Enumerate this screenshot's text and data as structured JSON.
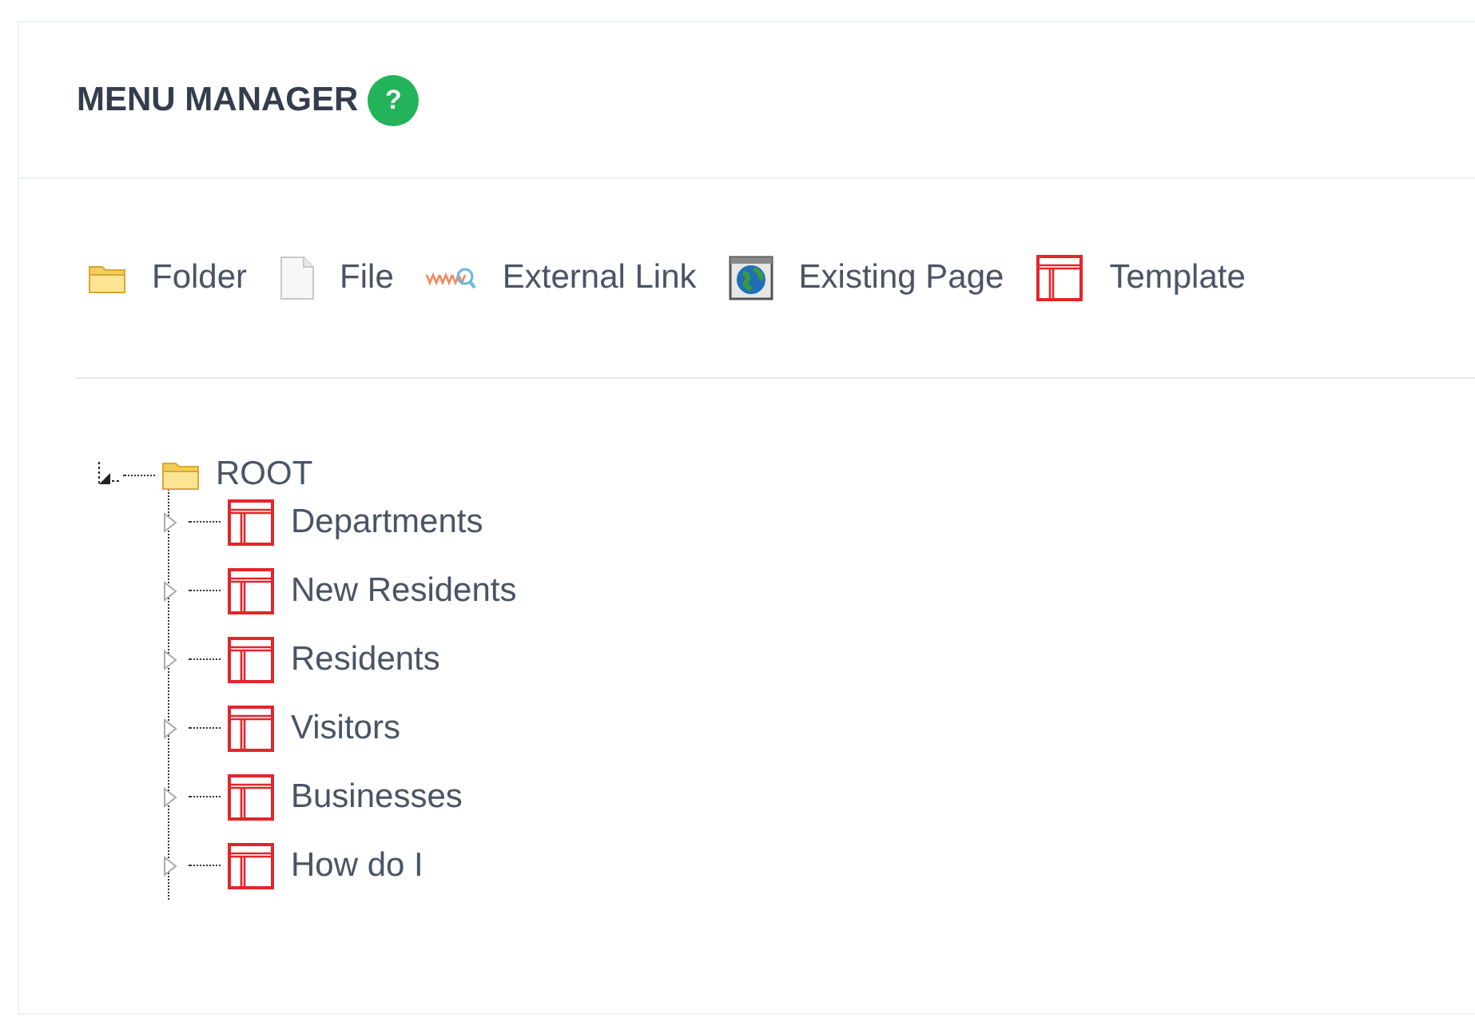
{
  "panel": {
    "title": "MENU MANAGER",
    "help": "?"
  },
  "toolbar": [
    {
      "kind": "folder",
      "label": "Folder"
    },
    {
      "kind": "file",
      "label": "File"
    },
    {
      "kind": "link",
      "label": "External Link"
    },
    {
      "kind": "page",
      "label": "Existing Page"
    },
    {
      "kind": "template",
      "label": "Template"
    }
  ],
  "tree": [
    {
      "kind": "folder",
      "label": "ROOT",
      "expanded": true,
      "children": [
        {
          "kind": "template",
          "label": "Departments",
          "expanded": false
        },
        {
          "kind": "template",
          "label": "New Residents",
          "expanded": false
        },
        {
          "kind": "template",
          "label": "Residents",
          "expanded": false
        },
        {
          "kind": "template",
          "label": "Visitors",
          "expanded": false
        },
        {
          "kind": "template",
          "label": "Businesses",
          "expanded": false
        },
        {
          "kind": "template",
          "label": "How do I",
          "expanded": false
        }
      ]
    }
  ]
}
